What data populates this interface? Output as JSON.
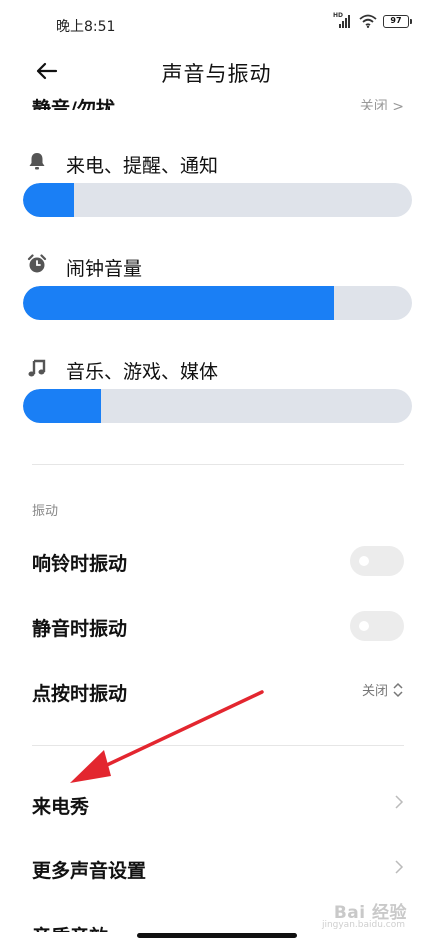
{
  "status_bar": {
    "time": "晚上8:51",
    "network_badge": "HD",
    "battery_level": "97"
  },
  "header": {
    "title": "声音与振动",
    "back_icon": "arrow-left-icon"
  },
  "clipped_row": {
    "label": "静音/勿扰",
    "value": "关闭 >"
  },
  "volume": {
    "ringtone": {
      "label": "来电、提醒、通知",
      "icon": "bell-icon",
      "level": 0.13
    },
    "alarm": {
      "label": "闹钟音量",
      "icon": "alarm-clock-icon",
      "level": 0.8
    },
    "media": {
      "label": "音乐、游戏、媒体",
      "icon": "music-note-icon",
      "level": 0.2
    }
  },
  "vibration": {
    "section_title": "振动",
    "ring_vibrate": {
      "label": "响铃时振动",
      "enabled": false
    },
    "silent_vibrate": {
      "label": "静音时振动",
      "enabled": false
    },
    "touch_vibrate": {
      "label": "点按时振动",
      "value": "关闭"
    }
  },
  "more": {
    "incoming_show": "来电秀",
    "more_sound": "更多声音设置",
    "next_row_partial": "音质音效"
  },
  "watermark": {
    "main": "Bai 经验",
    "sub": "jingyan.baidu.com"
  },
  "colors": {
    "accent": "#1a7ff5",
    "track": "#dfe3ea",
    "annotation_arrow": "#e3262f"
  }
}
